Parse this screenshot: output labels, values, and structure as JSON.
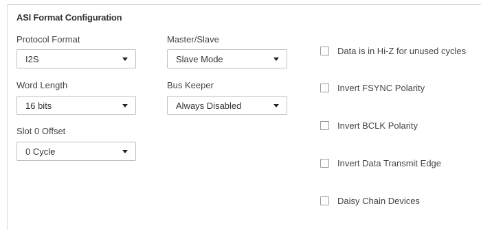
{
  "section": {
    "title": "ASI Format Configuration"
  },
  "fields": {
    "protocol_format": {
      "label": "Protocol Format",
      "value": "I2S"
    },
    "master_slave": {
      "label": "Master/Slave",
      "value": "Slave Mode"
    },
    "word_length": {
      "label": "Word Length",
      "value": "16 bits"
    },
    "bus_keeper": {
      "label": "Bus Keeper",
      "value": "Always Disabled"
    },
    "slot0_offset": {
      "label": "Slot 0 Offset",
      "value": "0 Cycle"
    }
  },
  "options": [
    {
      "label": "Data is in Hi-Z for unused cycles",
      "checked": false
    },
    {
      "label": "Invert FSYNC Polarity",
      "checked": false
    },
    {
      "label": "Invert BCLK Polarity",
      "checked": false
    },
    {
      "label": "Invert Data Transmit Edge",
      "checked": false
    },
    {
      "label": "Daisy Chain Devices",
      "checked": false
    }
  ]
}
